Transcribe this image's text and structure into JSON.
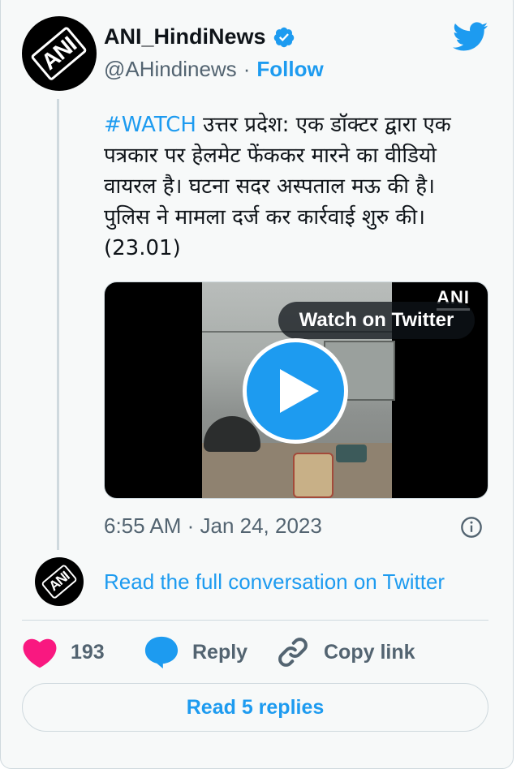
{
  "author": {
    "name": "ANI_HindiNews",
    "handle": "@AHindinews",
    "separator": "·",
    "follow_label": "Follow",
    "avatar_text": "ANI",
    "verified": true
  },
  "tweet": {
    "hashtag": "#WATCH",
    "body": " उत्तर प्रदेश: एक डॉक्टर द्वारा एक पत्रकार पर हेलमेट फेंककर मारने का वीडियो वायरल है। घटना सदर अस्पताल मऊ की है। पुलिस ने मामला दर्ज कर कार्रवाई शुरु की। (23.01)",
    "timestamp": "6:55 AM · Jan 24, 2023"
  },
  "media": {
    "watch_label": "Watch on Twitter",
    "watermark": "ANI"
  },
  "conversation": {
    "link_label": "Read the full conversation on Twitter",
    "avatar_text": "ANI"
  },
  "actions": {
    "like_count": "193",
    "reply_label": "Reply",
    "copy_label": "Copy link"
  },
  "replies": {
    "label": "Read 5 replies"
  },
  "colors": {
    "accent": "#1d9bf0",
    "like": "#f91880",
    "muted": "#536471",
    "card_bg": "#f7f9f9"
  },
  "icons": [
    "verified-badge-icon",
    "twitter-bird-icon",
    "play-icon",
    "info-icon",
    "heart-icon",
    "reply-bubble-icon",
    "link-icon"
  ]
}
